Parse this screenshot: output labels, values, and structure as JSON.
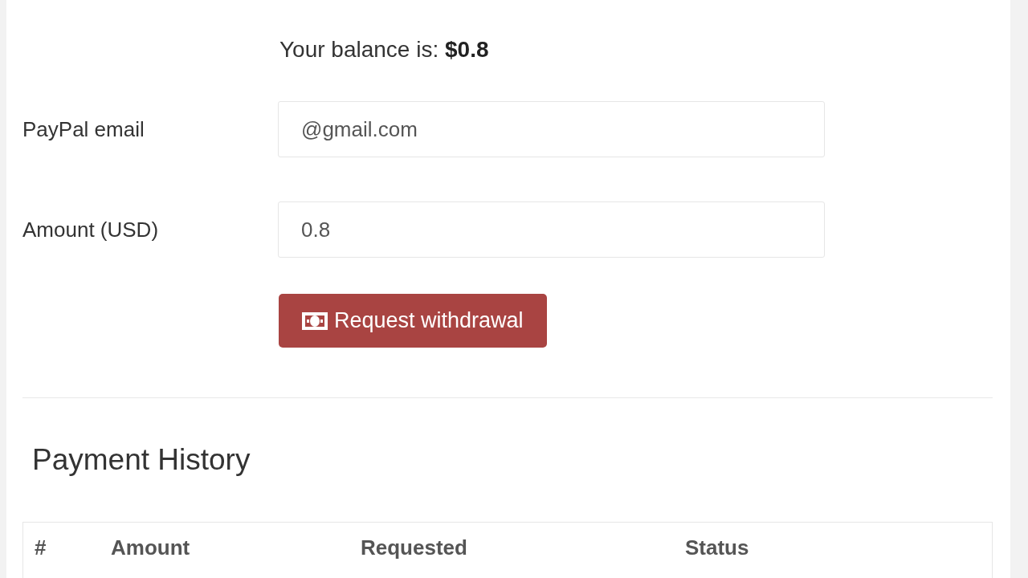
{
  "balance": {
    "label": "Your balance is:",
    "value": "$0.8"
  },
  "form": {
    "fields": [
      {
        "label": "PayPal email",
        "value": "@gmail.com"
      },
      {
        "label": "Amount (USD)",
        "value": "0.8"
      }
    ],
    "button": "Request withdrawal"
  },
  "payment_history": {
    "title": "Payment History",
    "columns": [
      "#",
      "Amount",
      "Requested",
      "Status"
    ]
  }
}
